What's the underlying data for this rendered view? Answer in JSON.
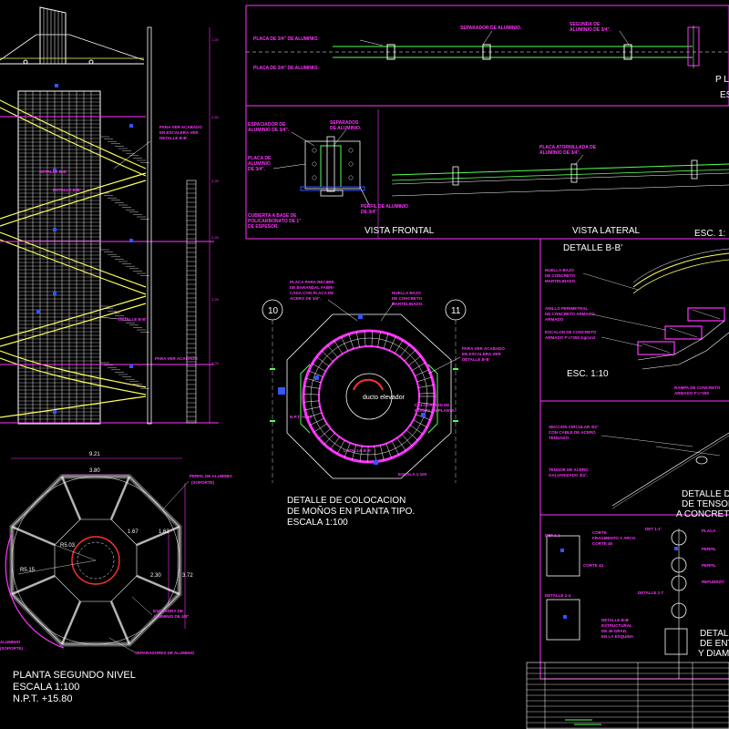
{
  "labels": {
    "planta_title": "PLANTA SEGUNDO NIVEL",
    "planta_escala": "ESCALA 1:100",
    "planta_npt": "N.P.T. +15.80",
    "detalle_title1": "DETALLE DE COLOCACION",
    "detalle_title2": "DE MOÑOS EN PLANTA TIPO.",
    "detalle_escala": "ESCALA 1:100",
    "vista_frontal": "VISTA FRONTAL",
    "vista_lateral": "VISTA LATERAL",
    "detalle_bb": "DETALLE B-B'",
    "esc_1_10": "ESC. 1:10",
    "esc_partial": "ESC. 1:",
    "p_partial": "P L",
    "es_partial": "ES",
    "detalle_de_partial": "DETALLE DE",
    "de_tensor_partial": "DE TENSOR",
    "a_concreto_partial": "A CONCRETO",
    "detall_partial": "DETALL",
    "de_ent_partial": "DE ENT",
    "y_diam_partial": "Y DIAM",
    "grid_10": "10",
    "grid_11": "11",
    "ducto_elevador": "ducto elevador",
    "aluminio_partial": "ALUMINIO",
    "soporte_partial": "(SOPORTE)"
  },
  "dimensions": {
    "d_921": "9.21",
    "d_380": "3.80",
    "d_167": "1.67",
    "d_162": "1.62",
    "d_230": "2.30",
    "d_372": "3.72",
    "r_515": "R5.15",
    "r_253": "R5.03",
    "perfil": "PERFIL DE ALUMINIO",
    "perfil_sub": "(SOPORTE)",
    "escuadra": "ESCUADRA DE",
    "escuadra2": "ALUMINIO DE 3/4\"",
    "separadores": "SEPARADORES DE ALUMINIO"
  },
  "notes": {
    "placa_34": "PLACA DE 3/4\" DE ALUMINIO.",
    "placa_34b": "PLACA DE 3/4\" DE ALUMINIO.",
    "separador": "SEPARADOR DE ALUMINIO.",
    "segunda": "SEGUNDA DE",
    "segunda2": "ALUMINIO DE 3/4\".",
    "espaciador": "ESPACIADOR DE",
    "espaciador2": "ALUMINIO DE 3/4\".",
    "separados": "SEPARADOS",
    "separados2": "DE ALUMINIO.",
    "placa_de": "PLACA DE",
    "placa_de2": "ALUMINIO",
    "placa_de3": "DE 3/4\".",
    "placa_atorn": "PLACA ATORNILLADA DE",
    "placa_atorn2": "ALUMINIO DE 3/4\".",
    "cubierta": "CUBIERTA A BASE DE",
    "cubierta2": "POLICARBONATO DE 1\"",
    "cubierta3": "DE ESPESOR.",
    "perfil_al": "PERFIL DE ALUMINIO",
    "perfil_al2": "DE 3/4\"",
    "para_ver": "PARA VER ACABADO",
    "para_ver2": "EN ESCALERA VER",
    "para_ver3": "DETALLE B-B'",
    "detalle_bbl": "DETALLE B-B'",
    "placa_recibir": "PLACA PARA RECIBIR",
    "placa_recibir2": "DE BARANDAL FABRI-",
    "placa_recibir3": "CADA CON PLACA DE",
    "placa_recibir4": "ACERO DE 3/4\".",
    "huella": "HUELLA BAJO",
    "huella2": "DE CONCRETO",
    "huella3": "MARTELINADO.",
    "para_ver_b": "PARA VER ACABADO",
    "para_ver_b2": "EN ESCALERA VER",
    "para_ver_b3": "DETALLE B-B'",
    "npt": "N.P.T. +5.65",
    "colocacion": "COLOCACION DE",
    "colocacion2": "MOÑOS EN PLANTA",
    "escala_100": "ESCALA 1:100",
    "huella_r": "HUELLA BAJO",
    "huella_r2": "DE CONCRETO",
    "huella_r3": "MARTELINADO.",
    "anillo": "ANILLO PERIMETRAL",
    "anillo2": "DE CONCRETO ARMADO",
    "anillo3": "ARMADO",
    "escalon": "ESCALON DE CONCRETO",
    "escalon2": "ARMADO F'c=250 Kg/cm2",
    "rampa": "RAMPA DE CONCRETO",
    "rampa2": "ARMADO F'c=250",
    "seccion": "SECCION CIRCULAR 3/4\"",
    "seccion2": "CON CABLE DE ACERO",
    "seccion3": "TENSADO.",
    "tensor": "TENSOR DE ACERO",
    "tensor2": "GALVANIZADO 3/4\".",
    "corte": "CORTE",
    "corte2": "FRAGMENTO Y ARCO",
    "corte3": "CORTE 45",
    "det_11": "DET 1-1",
    "det_11b": "DET 1-1'",
    "corte_44": "CORTE 44",
    "detalle_17": "DETALLE 1-7",
    "detalle_14": "DETALLE 1-4",
    "detalle_b": "DETALLE B-B'",
    "detalle_b2": "ESTRUCTURAL",
    "detalle_b3": "DE 45 GRAD.",
    "detalle_b4": "EN LA ESQUINA",
    "ps": "PLACA",
    "ps2": "PERFIL",
    "ps3": "PERFIL",
    "ps4": "REFUERZO"
  }
}
